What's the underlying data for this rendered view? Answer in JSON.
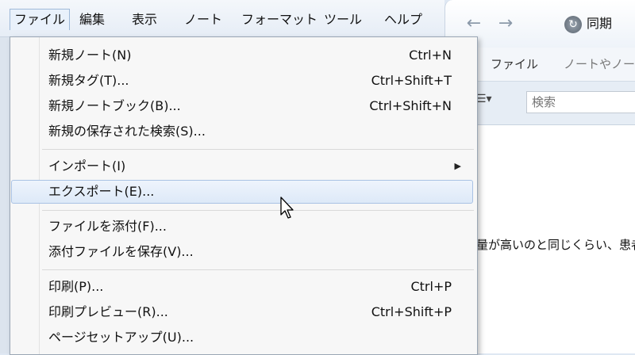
{
  "menubar": {
    "items": [
      "ファイル",
      "編集",
      "表示",
      "ノート",
      "フォーマット",
      "ツール",
      "ヘルプ"
    ],
    "active_index": 0
  },
  "toolbar": {
    "back_icon": "arrow-left-icon",
    "forward_icon": "arrow-right-icon",
    "sync_label": "同期",
    "sync_icon": "sync-icon"
  },
  "tabs": {
    "file_label": "ファイル",
    "notes_label": "ノートやノー"
  },
  "search": {
    "placeholder": "検索",
    "view_icon": "list-view-icon"
  },
  "note": {
    "snippet": "量が高いのと同じくらい、患者"
  },
  "file_menu": {
    "items": [
      {
        "label": "新規ノート(N)",
        "shortcut": "Ctrl+N"
      },
      {
        "label": "新規タグ(T)...",
        "shortcut": "Ctrl+Shift+T"
      },
      {
        "label": "新規ノートブック(B)...",
        "shortcut": "Ctrl+Shift+N"
      },
      {
        "label": "新規の保存された検索(S)...",
        "shortcut": ""
      },
      {
        "label": "インポート(I)",
        "shortcut": "",
        "submenu": true
      },
      {
        "label": "エクスポート(E)...",
        "shortcut": "",
        "highlighted": true
      },
      {
        "label": "ファイルを添付(F)...",
        "shortcut": ""
      },
      {
        "label": "添付ファイルを保存(V)...",
        "shortcut": ""
      },
      {
        "label": "印刷(P)...",
        "shortcut": "Ctrl+P"
      },
      {
        "label": "印刷プレビュー(R)...",
        "shortcut": "Ctrl+Shift+P"
      },
      {
        "label": "ページセットアップ(U)...",
        "shortcut": ""
      }
    ]
  },
  "colors": {
    "highlight_bg": "#dde9f8",
    "highlight_border": "#a9c2e4",
    "menu_bg": "#f7f7f7"
  }
}
